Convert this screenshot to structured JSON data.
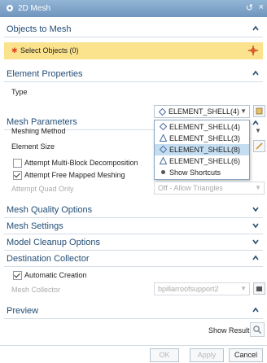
{
  "dialog": {
    "title": "2D Mesh"
  },
  "sections": {
    "objects_to_mesh": {
      "label": "Objects to Mesh",
      "select_objects": "Select Objects (0)"
    },
    "element_properties": {
      "label": "Element Properties",
      "type_label": "Type",
      "type_value": "ELEMENT_SHELL(4)"
    },
    "mesh_parameters": {
      "label": "Mesh Parameters",
      "meshing_method_label": "Meshing Method",
      "element_size_label": "Element Size",
      "multi_block_label": "Attempt Multi-Block Decomposition",
      "multi_block_checked": false,
      "free_mapped_label": "Attempt Free Mapped Meshing",
      "free_mapped_checked": true,
      "quad_only_label": "Attempt Quad Only",
      "quad_only_value": "Off - Allow Triangles"
    },
    "mesh_quality_options": {
      "label": "Mesh Quality Options"
    },
    "mesh_settings": {
      "label": "Mesh Settings"
    },
    "model_cleanup_options": {
      "label": "Model Cleanup Options"
    },
    "destination_collector": {
      "label": "Destination Collector",
      "automatic_creation_label": "Automatic Creation",
      "automatic_creation_checked": true,
      "mesh_collector_label": "Mesh Collector",
      "mesh_collector_value": "bpillarroofsupport2"
    },
    "preview": {
      "label": "Preview",
      "show_result_label": "Show Result"
    }
  },
  "type_dropdown": {
    "items": [
      {
        "label": "ELEMENT_SHELL(4)",
        "icon": "diamond-icon"
      },
      {
        "label": "ELEMENT_SHELL(3)",
        "icon": "triangle-icon"
      },
      {
        "label": "ELEMENT_SHELL(8)",
        "icon": "diamond-icon",
        "selected": true
      },
      {
        "label": "ELEMENT_SHELL(6)",
        "icon": "triangle-icon"
      },
      {
        "label": "Show Shortcuts",
        "icon": "shortcuts-icon"
      }
    ]
  },
  "buttons": {
    "ok": "OK",
    "apply": "Apply",
    "cancel": "Cancel"
  },
  "colors": {
    "title_bar": "#7aa0c6",
    "section_text": "#234e76",
    "selection_highlight": "#fbe38e",
    "required_star": "#e0461e"
  }
}
